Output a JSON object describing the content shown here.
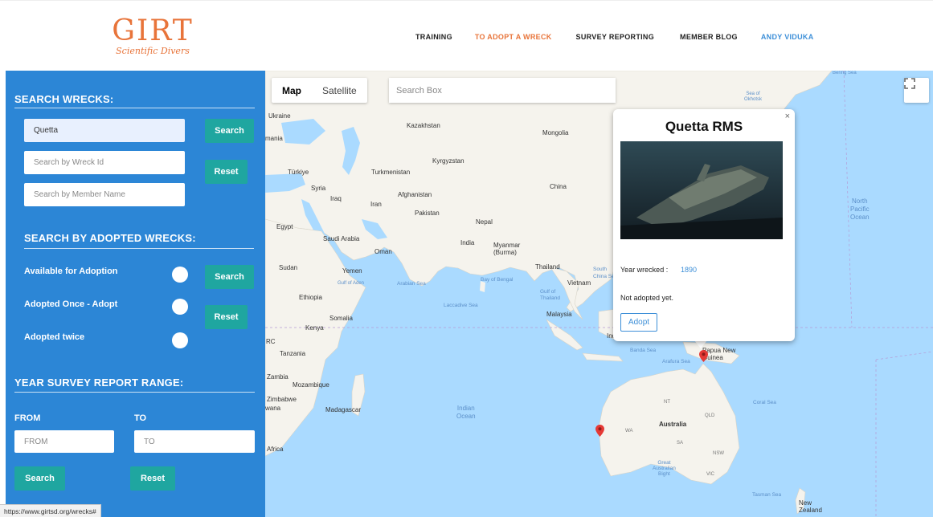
{
  "logo": {
    "mark": "GIRT",
    "subtitle": "Scientific Divers"
  },
  "nav": {
    "items": [
      {
        "label": "TRAINING",
        "name": "nav-training",
        "active": false
      },
      {
        "label": "TO ADOPT A WRECK",
        "name": "nav-adopt-a-wreck",
        "active": true
      },
      {
        "label": "SURVEY REPORTING",
        "name": "nav-survey-reporting",
        "active": false
      },
      {
        "label": "MEMBER BLOG",
        "name": "nav-member-blog",
        "active": false
      }
    ],
    "user": "ANDY VIDUKA"
  },
  "sidebar": {
    "search_wrecks": {
      "heading": "SEARCH WRECKS:",
      "name_value": "Quetta",
      "wreck_id_placeholder": "Search by Wreck Id",
      "member_placeholder": "Search by Member Name",
      "search_label": "Search",
      "reset_label": "Reset"
    },
    "adopted": {
      "heading": "SEARCH BY ADOPTED WRECKS:",
      "options": [
        "Available for Adoption",
        "Adopted Once - Adopt",
        "Adopted twice"
      ],
      "search_label": "Search",
      "reset_label": "Reset"
    },
    "year_range": {
      "heading": "YEAR SURVEY REPORT RANGE:",
      "from_label": "FROM",
      "to_label": "TO",
      "from_placeholder": "FROM",
      "to_placeholder": "TO",
      "search_label": "Search",
      "reset_label": "Reset"
    }
  },
  "map": {
    "type_buttons": [
      "Map",
      "Satellite"
    ],
    "selected_type": "Map",
    "search_placeholder": "Search Box",
    "labels": {
      "ukraine": "Ukraine",
      "kazakhstan": "Kazakhstan",
      "mongolia": "Mongolia",
      "mania": "mania",
      "kyrgyzstan": "Kyrgyzstan",
      "turkiye": "Türkiye",
      "turkmenistan": "Turkmenistan",
      "china": "China",
      "syria": "Syria",
      "iraq": "Iraq",
      "iran": "Iran",
      "afghanistan": "Afghanistan",
      "pakistan": "Pakistan",
      "nepal": "Nepal",
      "egypt": "Egypt",
      "saudi": "Saudi Arabia",
      "india": "India",
      "myanmar": "Myanmar\n(Burma)",
      "oman": "Oman",
      "sudan": "Sudan",
      "yemen": "Yemen",
      "thailand": "Thailand",
      "vietnam": "Vietnam",
      "ethiopia": "Ethiopia",
      "somalia": "Somalia",
      "malaysia": "Malaysia",
      "kenya": "Kenya",
      "indonesia": "Indones",
      "tanzania": "Tanzania",
      "png": "Papua New\nGuinea",
      "zambia": "Zambia",
      "mozambique": "Mozambique",
      "zimbabwe": "Zimbabwe",
      "wana": "wana",
      "madagascar": "Madagascar",
      "australia": "Australia",
      "africa": "Africa",
      "new_zealand": "New\nZealand",
      "rc": "RC",
      "wa": "WA",
      "nt": "NT",
      "qld": "QLD",
      "sa": "SA",
      "nsw": "NSW",
      "vic": "VIC",
      "south_china_sea": "South\nChina Se",
      "gulf_thailand": "Gulf of\nThailand",
      "gulf_aden": "Gulf of Aden"
    },
    "oceans": {
      "indian": "Indian\nOcean",
      "north_pacific": "North\nPacific\nOcean",
      "arabian_sea": "Arabian Sea",
      "bay_bengal": "Bay of Bengal",
      "laccadive": "Laccadive Sea",
      "banda": "Banda Sea",
      "arafura": "Arafura Sea",
      "coral": "Coral Sea",
      "tasman": "Tasman Sea",
      "great_bight": "Great\nAustralian\nBight",
      "okhotsk": "Sea of\nOkhotsk",
      "bering": "Bering Sea"
    }
  },
  "infowindow": {
    "title": "Quetta RMS",
    "year_label": "Year wrecked :",
    "year_value": "1890",
    "status": "Not adopted yet.",
    "adopt_label": "Adopt",
    "close_label": "×"
  },
  "statusbar": {
    "url": "https://www.girtsd.org/wrecks#"
  },
  "colors": {
    "sidebar": "#2c86d6",
    "button": "#1fa6a0",
    "accent": "#e8743a",
    "link": "#3d8fd8",
    "water": "#aadaff",
    "land": "#f5f3ed"
  }
}
